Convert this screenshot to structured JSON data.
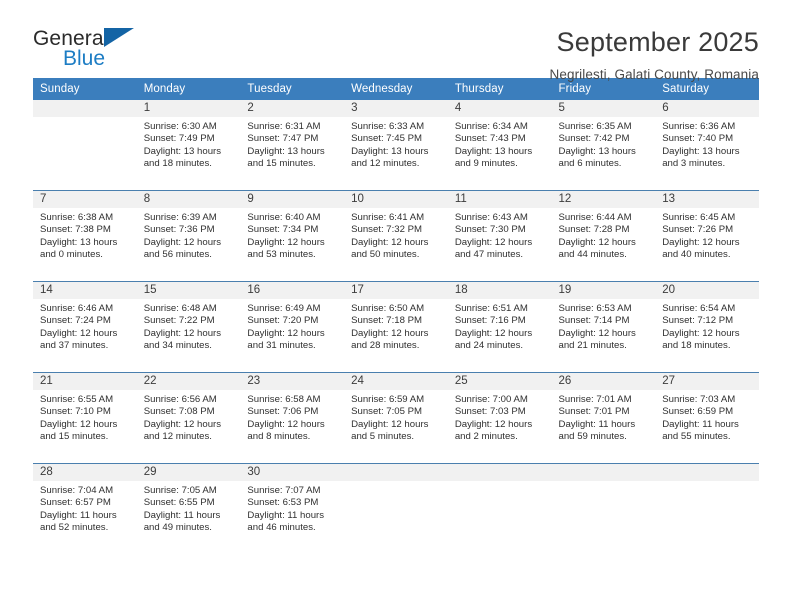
{
  "brand": {
    "name_part1": "General",
    "name_part2": "Blue",
    "triangle_color": "#1464a5",
    "blue_text_color": "#1d7dc4"
  },
  "header": {
    "title": "September 2025",
    "subtitle": "Negrilesti, Galati County, Romania"
  },
  "theme": {
    "header_row_bg": "#3b7ebd",
    "daynum_band_bg": "#f1f1f1",
    "row_separator": "#4a7fae",
    "text_color": "#303030"
  },
  "calendar": {
    "weekday_headers": [
      "Sunday",
      "Monday",
      "Tuesday",
      "Wednesday",
      "Thursday",
      "Friday",
      "Saturday"
    ],
    "weeks": [
      [
        {
          "day": "",
          "lines": []
        },
        {
          "day": "1",
          "lines": [
            "Sunrise: 6:30 AM",
            "Sunset: 7:49 PM",
            "Daylight: 13 hours",
            "and 18 minutes."
          ]
        },
        {
          "day": "2",
          "lines": [
            "Sunrise: 6:31 AM",
            "Sunset: 7:47 PM",
            "Daylight: 13 hours",
            "and 15 minutes."
          ]
        },
        {
          "day": "3",
          "lines": [
            "Sunrise: 6:33 AM",
            "Sunset: 7:45 PM",
            "Daylight: 13 hours",
            "and 12 minutes."
          ]
        },
        {
          "day": "4",
          "lines": [
            "Sunrise: 6:34 AM",
            "Sunset: 7:43 PM",
            "Daylight: 13 hours",
            "and 9 minutes."
          ]
        },
        {
          "day": "5",
          "lines": [
            "Sunrise: 6:35 AM",
            "Sunset: 7:42 PM",
            "Daylight: 13 hours",
            "and 6 minutes."
          ]
        },
        {
          "day": "6",
          "lines": [
            "Sunrise: 6:36 AM",
            "Sunset: 7:40 PM",
            "Daylight: 13 hours",
            "and 3 minutes."
          ]
        }
      ],
      [
        {
          "day": "7",
          "lines": [
            "Sunrise: 6:38 AM",
            "Sunset: 7:38 PM",
            "Daylight: 13 hours",
            "and 0 minutes."
          ]
        },
        {
          "day": "8",
          "lines": [
            "Sunrise: 6:39 AM",
            "Sunset: 7:36 PM",
            "Daylight: 12 hours",
            "and 56 minutes."
          ]
        },
        {
          "day": "9",
          "lines": [
            "Sunrise: 6:40 AM",
            "Sunset: 7:34 PM",
            "Daylight: 12 hours",
            "and 53 minutes."
          ]
        },
        {
          "day": "10",
          "lines": [
            "Sunrise: 6:41 AM",
            "Sunset: 7:32 PM",
            "Daylight: 12 hours",
            "and 50 minutes."
          ]
        },
        {
          "day": "11",
          "lines": [
            "Sunrise: 6:43 AM",
            "Sunset: 7:30 PM",
            "Daylight: 12 hours",
            "and 47 minutes."
          ]
        },
        {
          "day": "12",
          "lines": [
            "Sunrise: 6:44 AM",
            "Sunset: 7:28 PM",
            "Daylight: 12 hours",
            "and 44 minutes."
          ]
        },
        {
          "day": "13",
          "lines": [
            "Sunrise: 6:45 AM",
            "Sunset: 7:26 PM",
            "Daylight: 12 hours",
            "and 40 minutes."
          ]
        }
      ],
      [
        {
          "day": "14",
          "lines": [
            "Sunrise: 6:46 AM",
            "Sunset: 7:24 PM",
            "Daylight: 12 hours",
            "and 37 minutes."
          ]
        },
        {
          "day": "15",
          "lines": [
            "Sunrise: 6:48 AM",
            "Sunset: 7:22 PM",
            "Daylight: 12 hours",
            "and 34 minutes."
          ]
        },
        {
          "day": "16",
          "lines": [
            "Sunrise: 6:49 AM",
            "Sunset: 7:20 PM",
            "Daylight: 12 hours",
            "and 31 minutes."
          ]
        },
        {
          "day": "17",
          "lines": [
            "Sunrise: 6:50 AM",
            "Sunset: 7:18 PM",
            "Daylight: 12 hours",
            "and 28 minutes."
          ]
        },
        {
          "day": "18",
          "lines": [
            "Sunrise: 6:51 AM",
            "Sunset: 7:16 PM",
            "Daylight: 12 hours",
            "and 24 minutes."
          ]
        },
        {
          "day": "19",
          "lines": [
            "Sunrise: 6:53 AM",
            "Sunset: 7:14 PM",
            "Daylight: 12 hours",
            "and 21 minutes."
          ]
        },
        {
          "day": "20",
          "lines": [
            "Sunrise: 6:54 AM",
            "Sunset: 7:12 PM",
            "Daylight: 12 hours",
            "and 18 minutes."
          ]
        }
      ],
      [
        {
          "day": "21",
          "lines": [
            "Sunrise: 6:55 AM",
            "Sunset: 7:10 PM",
            "Daylight: 12 hours",
            "and 15 minutes."
          ]
        },
        {
          "day": "22",
          "lines": [
            "Sunrise: 6:56 AM",
            "Sunset: 7:08 PM",
            "Daylight: 12 hours",
            "and 12 minutes."
          ]
        },
        {
          "day": "23",
          "lines": [
            "Sunrise: 6:58 AM",
            "Sunset: 7:06 PM",
            "Daylight: 12 hours",
            "and 8 minutes."
          ]
        },
        {
          "day": "24",
          "lines": [
            "Sunrise: 6:59 AM",
            "Sunset: 7:05 PM",
            "Daylight: 12 hours",
            "and 5 minutes."
          ]
        },
        {
          "day": "25",
          "lines": [
            "Sunrise: 7:00 AM",
            "Sunset: 7:03 PM",
            "Daylight: 12 hours",
            "and 2 minutes."
          ]
        },
        {
          "day": "26",
          "lines": [
            "Sunrise: 7:01 AM",
            "Sunset: 7:01 PM",
            "Daylight: 11 hours",
            "and 59 minutes."
          ]
        },
        {
          "day": "27",
          "lines": [
            "Sunrise: 7:03 AM",
            "Sunset: 6:59 PM",
            "Daylight: 11 hours",
            "and 55 minutes."
          ]
        }
      ],
      [
        {
          "day": "28",
          "lines": [
            "Sunrise: 7:04 AM",
            "Sunset: 6:57 PM",
            "Daylight: 11 hours",
            "and 52 minutes."
          ]
        },
        {
          "day": "29",
          "lines": [
            "Sunrise: 7:05 AM",
            "Sunset: 6:55 PM",
            "Daylight: 11 hours",
            "and 49 minutes."
          ]
        },
        {
          "day": "30",
          "lines": [
            "Sunrise: 7:07 AM",
            "Sunset: 6:53 PM",
            "Daylight: 11 hours",
            "and 46 minutes."
          ]
        },
        {
          "day": "",
          "lines": []
        },
        {
          "day": "",
          "lines": []
        },
        {
          "day": "",
          "lines": []
        },
        {
          "day": "",
          "lines": []
        }
      ]
    ]
  }
}
